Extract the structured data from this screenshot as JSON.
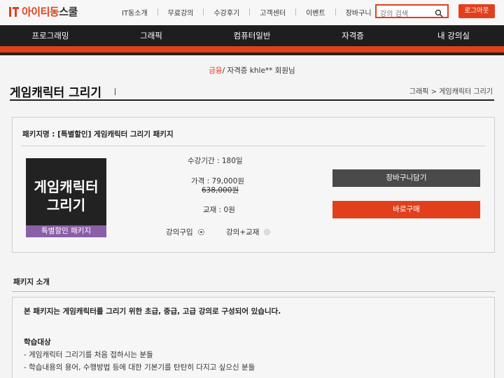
{
  "header": {
    "logo_primary": "아이티동",
    "logo_secondary": "스쿨",
    "top_links": [
      "IT동소개",
      "무료강의",
      "수강후기",
      "고객센터",
      "이벤트",
      "장바구니"
    ],
    "search_placeholder": "강의 검색",
    "logout_label": "로그아웃"
  },
  "main_nav": [
    "프로그래밍",
    "그래픽",
    "컴퓨터일반",
    "자격증",
    "내 강의실"
  ],
  "greeting": {
    "highlight": "금융",
    "text": "/ 자격증 khle** 회원님"
  },
  "page": {
    "title": "게임캐릭터 그리기",
    "breadcrumb": "그래픽 > 게임캐릭터 그리기"
  },
  "package": {
    "name_label": "패키지명 : [특별할인] 게임캐릭터 그리기 패키지",
    "thumb_title_line1": "게임캐릭터",
    "thumb_title_line2": "그리기",
    "thumb_band": "특별할인 패키지",
    "period": "수강기간 : 180일",
    "price": "가격 : 79,000원",
    "original_price": "638,000원",
    "textbook": "교재 : 0원",
    "option_lecture": "강의구입",
    "option_lecture_book": "강의+교재",
    "selected_option": "강의구입",
    "cart_button": "장바구니담기",
    "buy_button": "바로구매"
  },
  "intro": {
    "section_label": "패키지 소개",
    "lead": "본 패키지는 게임캐릭터를 그리기 위한 초급, 중급, 고급 강의로 구성되어 있습니다.",
    "target_title": "학습대상",
    "targets": [
      "- 게임캐릭터 그리기를 처음 접하시는 분들",
      "- 학습내용의 용어, 수행방법 등에 대한 기본기를 탄탄히 다지고 싶으신 분들"
    ]
  },
  "colors": {
    "accent": "#e2401c",
    "nav_bg": "#1e1e1e",
    "cart_button": "#4a4a4a",
    "thumb_band": "#8a5fa8"
  }
}
